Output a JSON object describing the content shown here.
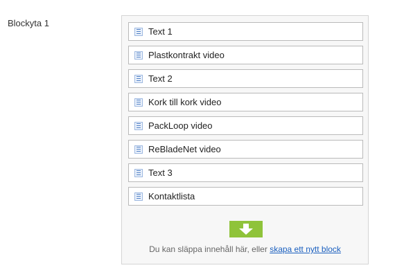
{
  "field": {
    "label": "Blockyta 1"
  },
  "content_area": {
    "blocks": [
      {
        "label": "Text 1",
        "icon": "block-icon"
      },
      {
        "label": "Plastkontrakt video",
        "icon": "block-icon"
      },
      {
        "label": "Text 2",
        "icon": "block-icon"
      },
      {
        "label": "Kork till kork video",
        "icon": "block-icon"
      },
      {
        "label": "PackLoop video",
        "icon": "block-icon"
      },
      {
        "label": "ReBladeNet video",
        "icon": "block-icon"
      },
      {
        "label": "Text 3",
        "icon": "block-icon"
      },
      {
        "label": "Kontaktlista",
        "icon": "block-icon"
      }
    ],
    "drop_zone": {
      "icon": "arrow-down-icon",
      "text": "Du kan släppa innehåll här, eller",
      "link_text": "skapa ett nytt block"
    }
  },
  "colors": {
    "drop_button": "#8fc33a",
    "link": "#1a5fbf",
    "block_border": "#b9b9b9",
    "icon_blue": "#4f7fc5"
  }
}
